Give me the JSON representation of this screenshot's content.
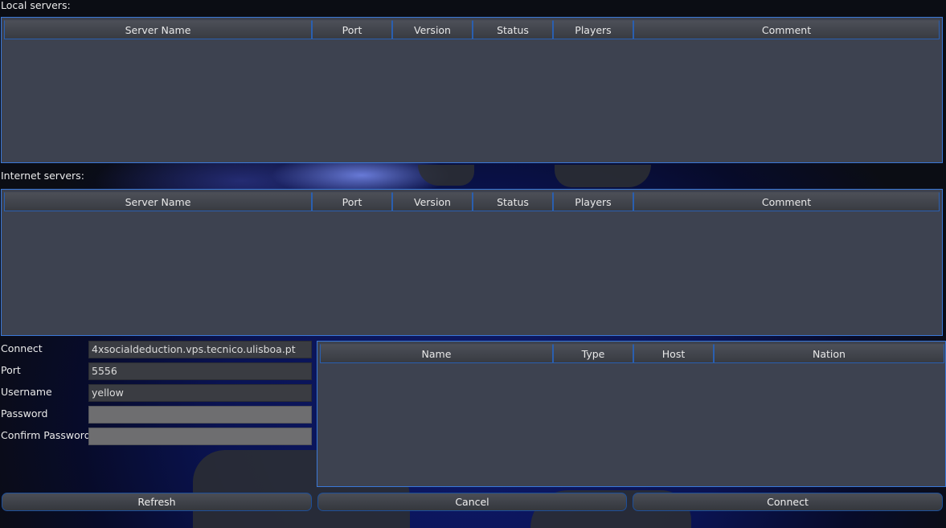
{
  "local_servers": {
    "label": "Local servers:",
    "columns": [
      "Server Name",
      "Port",
      "Version",
      "Status",
      "Players",
      "Comment"
    ],
    "rows": []
  },
  "internet_servers": {
    "label": "Internet servers:",
    "columns": [
      "Server Name",
      "Port",
      "Version",
      "Status",
      "Players",
      "Comment"
    ],
    "rows": []
  },
  "form": {
    "connect_label": "Connect",
    "connect_value": "4xsocialdeduction.vps.tecnico.ulisboa.pt",
    "port_label": "Port",
    "port_value": "5556",
    "username_label": "Username",
    "username_value": "yellow",
    "password_label": "Password",
    "password_value": "",
    "confirm_password_label": "Confirm Password",
    "confirm_password_value": ""
  },
  "players": {
    "columns": [
      "Name",
      "Type",
      "Host",
      "Nation"
    ],
    "rows": []
  },
  "buttons": {
    "refresh": "Refresh",
    "cancel": "Cancel",
    "connect": "Connect"
  },
  "colors": {
    "panel_bg": "#3d4250",
    "panel_border": "#3a78d8",
    "background": "#0b1352"
  }
}
